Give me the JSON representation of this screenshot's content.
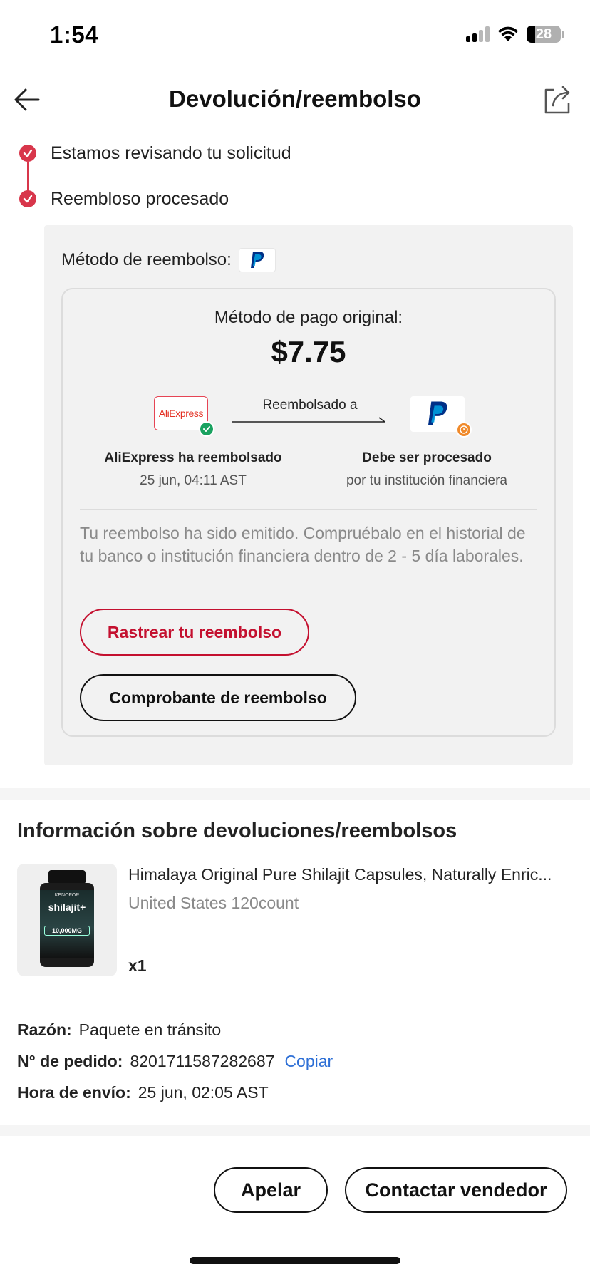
{
  "status_bar": {
    "time": "1:54",
    "battery": "28"
  },
  "header": {
    "title": "Devolución/reembolso"
  },
  "timeline": [
    {
      "label": "Estamos revisando tu solicitud"
    },
    {
      "label": "Reembloso procesado"
    }
  ],
  "refund": {
    "method_label": "Método de reembolso:",
    "original_label": "Método de pago original:",
    "amount": "$7.75",
    "aliexpress_logo_text": "AliExpress",
    "arrow_label": "Reembolsado a",
    "left_title": "AliExpress ha reembolsado",
    "left_sub": "25 jun, 04:11 AST",
    "right_title": "Debe ser procesado",
    "right_sub": "por tu institución financiera",
    "note": "Tu reembolso ha sido emitido. Compruébalo en el historial de tu banco o institución financiera dentro de 2 - 5 día laborales.",
    "track_button": "Rastrear tu reembolso",
    "receipt_button": "Comprobante de reembolso"
  },
  "info": {
    "title": "Información sobre devoluciones/reembolsos",
    "product": {
      "name": "Himalaya Original Pure Shilajit Capsules, Naturally Enric...",
      "variant": "United States 120count",
      "qty": "x1",
      "bottle_brand": "KENOFOR",
      "bottle_name": "shilajit+",
      "bottle_dose": "10,000MG"
    },
    "reason_label": "Razón:",
    "reason_value": "Paquete en tránsito",
    "order_label": "N° de pedido:",
    "order_value": "8201711587282687",
    "copy_label": "Copiar",
    "ship_label": "Hora de envío:",
    "ship_value": "25 jun, 02:05 AST"
  },
  "bottom": {
    "appeal_button": "Apelar",
    "contact_button": "Contactar vendedor"
  },
  "colors": {
    "accent_red": "#c4102f",
    "timeline_red": "#d8364b",
    "link_blue": "#2d6fd6",
    "check_green": "#1aa260",
    "clock_orange": "#f08a2b",
    "paypal_dark": "#003087",
    "paypal_light": "#009cde"
  }
}
